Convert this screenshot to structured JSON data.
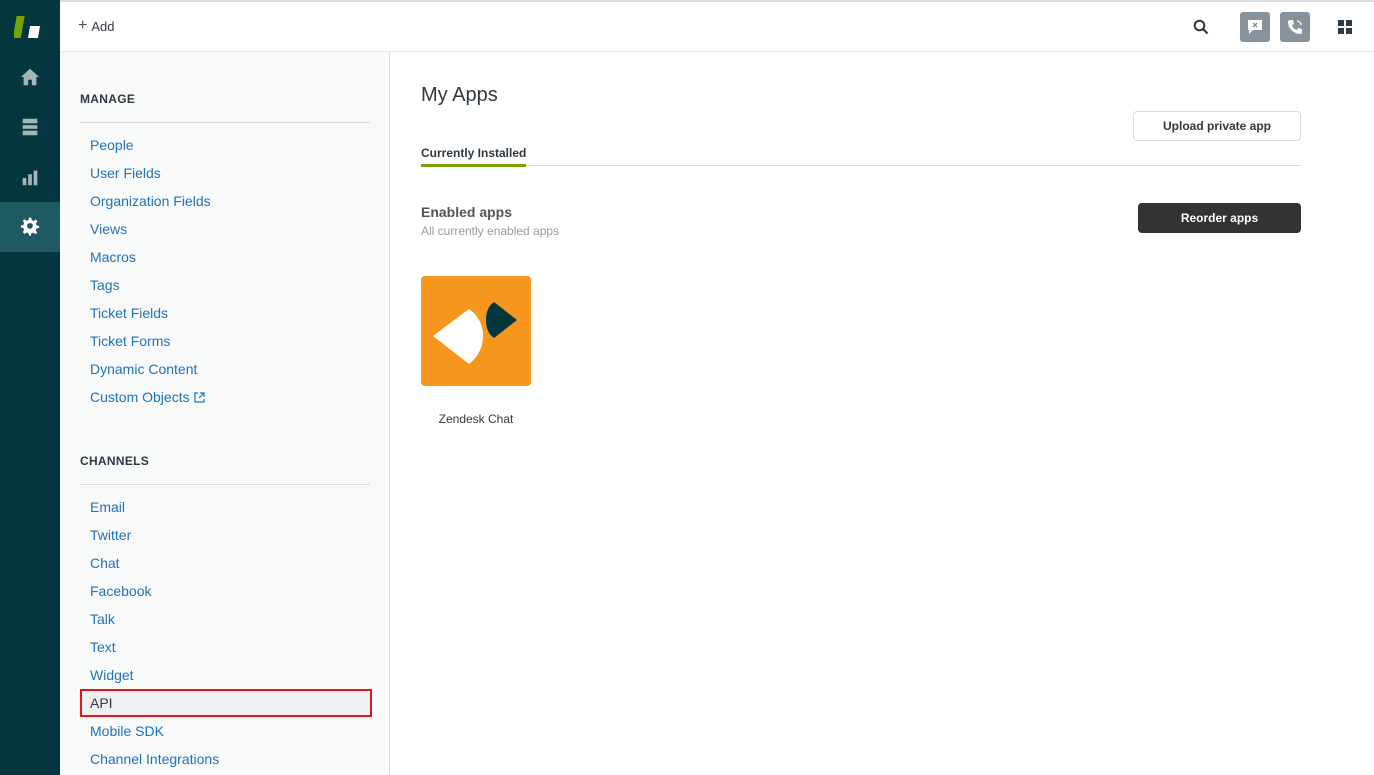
{
  "topbar": {
    "add_label": "Add"
  },
  "sidebar": {
    "manage_title": "MANAGE",
    "manage_items": [
      "People",
      "User Fields",
      "Organization Fields",
      "Views",
      "Macros",
      "Tags",
      "Ticket Fields",
      "Ticket Forms",
      "Dynamic Content",
      "Custom Objects"
    ],
    "channels_title": "CHANNELS",
    "channels_items": [
      "Email",
      "Twitter",
      "Chat",
      "Facebook",
      "Talk",
      "Text",
      "Widget",
      "API",
      "Mobile SDK",
      "Channel Integrations"
    ],
    "selected_item": "API"
  },
  "main": {
    "title": "My Apps",
    "upload_label": "Upload private app",
    "tab_label": "Currently Installed",
    "enabled_title": "Enabled apps",
    "enabled_subtitle": "All currently enabled apps",
    "reorder_label": "Reorder apps",
    "apps": [
      {
        "name": "Zendesk Chat"
      }
    ]
  },
  "colors": {
    "rail_bg": "#03363d",
    "link": "#1f73b7",
    "tab_accent": "#78a300",
    "app_tile": "#f7961d",
    "highlight_border": "#e3161d"
  },
  "icons": {
    "rail": [
      "zendesk-logo-icon",
      "home-icon",
      "views-icon",
      "reporting-icon",
      "admin-gear-icon"
    ],
    "topbar": [
      "search-icon",
      "chat-icon",
      "phone-icon",
      "apps-grid-icon"
    ]
  }
}
